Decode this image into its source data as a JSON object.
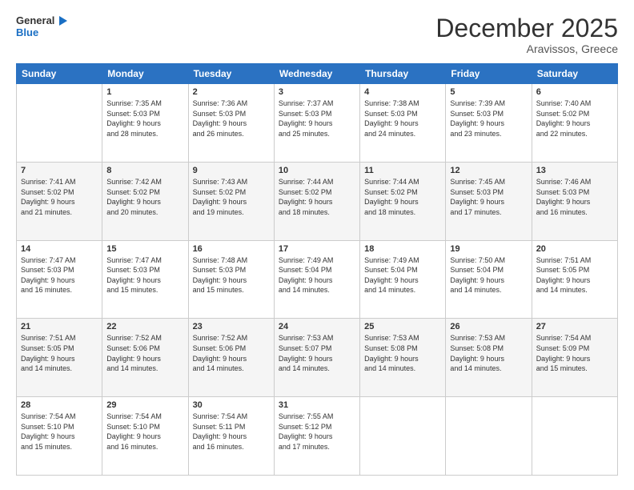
{
  "logo": {
    "line1": "General",
    "line2": "Blue"
  },
  "title": "December 2025",
  "subtitle": "Aravissos, Greece",
  "header_days": [
    "Sunday",
    "Monday",
    "Tuesday",
    "Wednesday",
    "Thursday",
    "Friday",
    "Saturday"
  ],
  "weeks": [
    [
      {
        "day": "",
        "info": ""
      },
      {
        "day": "1",
        "info": "Sunrise: 7:35 AM\nSunset: 5:03 PM\nDaylight: 9 hours\nand 28 minutes."
      },
      {
        "day": "2",
        "info": "Sunrise: 7:36 AM\nSunset: 5:03 PM\nDaylight: 9 hours\nand 26 minutes."
      },
      {
        "day": "3",
        "info": "Sunrise: 7:37 AM\nSunset: 5:03 PM\nDaylight: 9 hours\nand 25 minutes."
      },
      {
        "day": "4",
        "info": "Sunrise: 7:38 AM\nSunset: 5:03 PM\nDaylight: 9 hours\nand 24 minutes."
      },
      {
        "day": "5",
        "info": "Sunrise: 7:39 AM\nSunset: 5:03 PM\nDaylight: 9 hours\nand 23 minutes."
      },
      {
        "day": "6",
        "info": "Sunrise: 7:40 AM\nSunset: 5:02 PM\nDaylight: 9 hours\nand 22 minutes."
      }
    ],
    [
      {
        "day": "7",
        "info": "Sunrise: 7:41 AM\nSunset: 5:02 PM\nDaylight: 9 hours\nand 21 minutes."
      },
      {
        "day": "8",
        "info": "Sunrise: 7:42 AM\nSunset: 5:02 PM\nDaylight: 9 hours\nand 20 minutes."
      },
      {
        "day": "9",
        "info": "Sunrise: 7:43 AM\nSunset: 5:02 PM\nDaylight: 9 hours\nand 19 minutes."
      },
      {
        "day": "10",
        "info": "Sunrise: 7:44 AM\nSunset: 5:02 PM\nDaylight: 9 hours\nand 18 minutes."
      },
      {
        "day": "11",
        "info": "Sunrise: 7:44 AM\nSunset: 5:02 PM\nDaylight: 9 hours\nand 18 minutes."
      },
      {
        "day": "12",
        "info": "Sunrise: 7:45 AM\nSunset: 5:03 PM\nDaylight: 9 hours\nand 17 minutes."
      },
      {
        "day": "13",
        "info": "Sunrise: 7:46 AM\nSunset: 5:03 PM\nDaylight: 9 hours\nand 16 minutes."
      }
    ],
    [
      {
        "day": "14",
        "info": "Sunrise: 7:47 AM\nSunset: 5:03 PM\nDaylight: 9 hours\nand 16 minutes."
      },
      {
        "day": "15",
        "info": "Sunrise: 7:47 AM\nSunset: 5:03 PM\nDaylight: 9 hours\nand 15 minutes."
      },
      {
        "day": "16",
        "info": "Sunrise: 7:48 AM\nSunset: 5:03 PM\nDaylight: 9 hours\nand 15 minutes."
      },
      {
        "day": "17",
        "info": "Sunrise: 7:49 AM\nSunset: 5:04 PM\nDaylight: 9 hours\nand 14 minutes."
      },
      {
        "day": "18",
        "info": "Sunrise: 7:49 AM\nSunset: 5:04 PM\nDaylight: 9 hours\nand 14 minutes."
      },
      {
        "day": "19",
        "info": "Sunrise: 7:50 AM\nSunset: 5:04 PM\nDaylight: 9 hours\nand 14 minutes."
      },
      {
        "day": "20",
        "info": "Sunrise: 7:51 AM\nSunset: 5:05 PM\nDaylight: 9 hours\nand 14 minutes."
      }
    ],
    [
      {
        "day": "21",
        "info": "Sunrise: 7:51 AM\nSunset: 5:05 PM\nDaylight: 9 hours\nand 14 minutes."
      },
      {
        "day": "22",
        "info": "Sunrise: 7:52 AM\nSunset: 5:06 PM\nDaylight: 9 hours\nand 14 minutes."
      },
      {
        "day": "23",
        "info": "Sunrise: 7:52 AM\nSunset: 5:06 PM\nDaylight: 9 hours\nand 14 minutes."
      },
      {
        "day": "24",
        "info": "Sunrise: 7:53 AM\nSunset: 5:07 PM\nDaylight: 9 hours\nand 14 minutes."
      },
      {
        "day": "25",
        "info": "Sunrise: 7:53 AM\nSunset: 5:08 PM\nDaylight: 9 hours\nand 14 minutes."
      },
      {
        "day": "26",
        "info": "Sunrise: 7:53 AM\nSunset: 5:08 PM\nDaylight: 9 hours\nand 14 minutes."
      },
      {
        "day": "27",
        "info": "Sunrise: 7:54 AM\nSunset: 5:09 PM\nDaylight: 9 hours\nand 15 minutes."
      }
    ],
    [
      {
        "day": "28",
        "info": "Sunrise: 7:54 AM\nSunset: 5:10 PM\nDaylight: 9 hours\nand 15 minutes."
      },
      {
        "day": "29",
        "info": "Sunrise: 7:54 AM\nSunset: 5:10 PM\nDaylight: 9 hours\nand 16 minutes."
      },
      {
        "day": "30",
        "info": "Sunrise: 7:54 AM\nSunset: 5:11 PM\nDaylight: 9 hours\nand 16 minutes."
      },
      {
        "day": "31",
        "info": "Sunrise: 7:55 AM\nSunset: 5:12 PM\nDaylight: 9 hours\nand 17 minutes."
      },
      {
        "day": "",
        "info": ""
      },
      {
        "day": "",
        "info": ""
      },
      {
        "day": "",
        "info": ""
      }
    ]
  ]
}
